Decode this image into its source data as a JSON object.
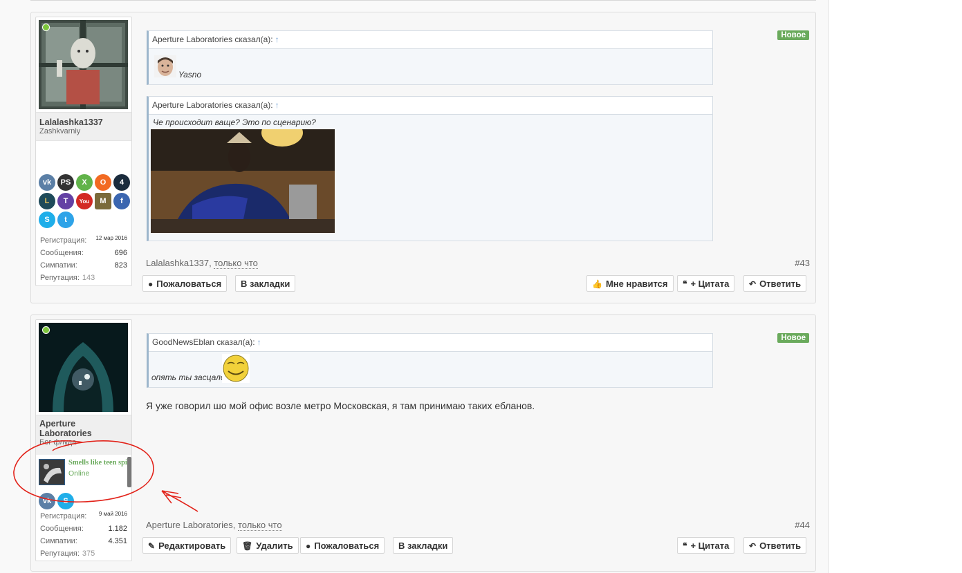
{
  "posts": [
    {
      "author": "Lalalashka1337",
      "user_title": "Zashkvarniy",
      "badge": "Новое",
      "stats": {
        "reg_label": "Регистрация:",
        "reg_value": "12 мар 2016",
        "msg_label": "Сообщения:",
        "msg_value": "696",
        "likes_label": "Симпатии:",
        "likes_value": "823",
        "rep_label": "Репутация:",
        "rep_value": "143"
      },
      "social_icons": [
        {
          "name": "vk-icon",
          "glyph": "vk",
          "color": "#5b7fa6"
        },
        {
          "name": "playstation-icon",
          "glyph": "PS",
          "color": "#333333"
        },
        {
          "name": "xbox-icon",
          "glyph": "X",
          "color": "#61b34a"
        },
        {
          "name": "origin-icon",
          "glyph": "O",
          "color": "#f26a22"
        },
        {
          "name": "battlenet-icon",
          "glyph": "4",
          "color": "#1b2c3d"
        },
        {
          "name": "lol-icon",
          "glyph": "L",
          "color": "#1e4a5a"
        },
        {
          "name": "twitch-icon",
          "glyph": "T",
          "color": "#6441a4"
        },
        {
          "name": "youtube-icon",
          "glyph": "You",
          "color": "#d32a24"
        },
        {
          "name": "minecraft-icon",
          "glyph": "M",
          "color": "#7a6a3a"
        },
        {
          "name": "facebook-icon",
          "glyph": "f",
          "color": "#3b66b0"
        },
        {
          "name": "skype-icon",
          "glyph": "S",
          "color": "#1faee9"
        },
        {
          "name": "twitter-icon",
          "glyph": "t",
          "color": "#2ea3e8"
        }
      ],
      "quotes": [
        {
          "author_line": "Aperture Laboratories сказал(а):",
          "arrow": "↑",
          "text": "Yasno"
        },
        {
          "author_line": "Aperture Laboratories сказал(а):",
          "arrow": "↑",
          "text": "Че происходит ваще? Это по сценарию?"
        }
      ],
      "meta_author": "Lalalashka1337",
      "meta_time": "только что",
      "post_number": "#43",
      "actions_left": [
        "Пожаловаться",
        "В закладки"
      ],
      "actions_right": [
        "Мне нравится",
        "+ Цитата",
        "Ответить"
      ]
    },
    {
      "author": "Aperture Laboratories",
      "user_title": "Бог флуда",
      "badge": "Новое",
      "spotify": {
        "track": "Smells like teen spirit",
        "status": "Online"
      },
      "stats": {
        "reg_label": "Регистрация:",
        "reg_value": "9 май 2016",
        "msg_label": "Сообщения:",
        "msg_value": "1.182",
        "likes_label": "Симпатии:",
        "likes_value": "4.351",
        "rep_label": "Репутация:",
        "rep_value": "375"
      },
      "social_icons": [
        {
          "name": "vk-icon",
          "glyph": "vk",
          "color": "#5b7fa6"
        },
        {
          "name": "skype-icon",
          "glyph": "S",
          "color": "#1faee9"
        }
      ],
      "quotes": [
        {
          "author_line": "GoodNewsEblan сказал(а):",
          "arrow": "↑",
          "text": "опять ты засцало"
        }
      ],
      "message": "Я уже говорил шо мой офис возле метро Московская, я там принимаю таких ебланов.",
      "meta_author": "Aperture Laboratories",
      "meta_time": "только что",
      "post_number": "#44",
      "actions_left": [
        "Редактировать",
        "Удалить",
        "Пожаловаться",
        "В закладки"
      ],
      "actions_right": [
        "+ Цитата",
        "Ответить"
      ]
    }
  ]
}
